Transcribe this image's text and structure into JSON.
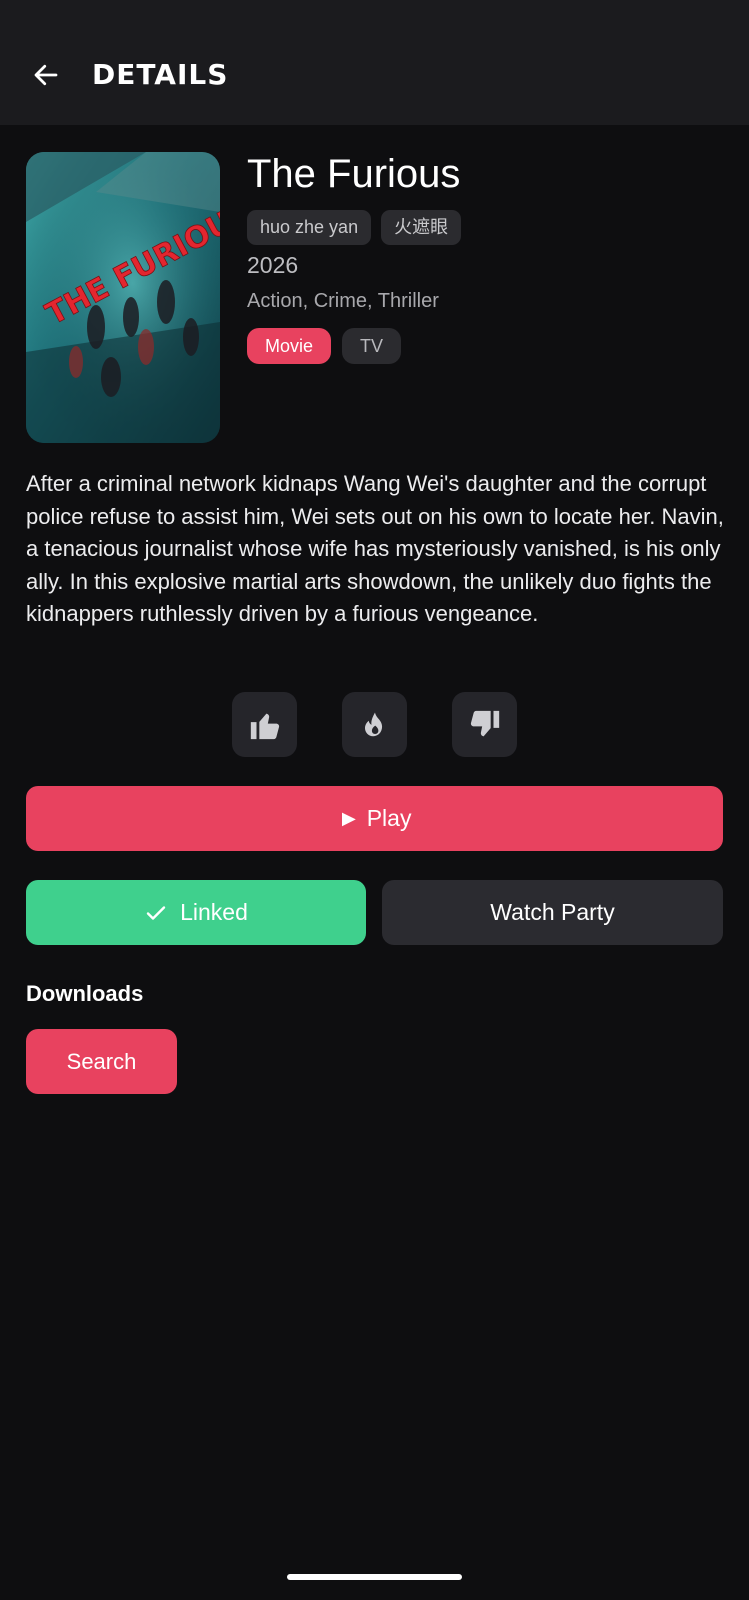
{
  "header": {
    "title": "DETAILS",
    "back_icon": "arrow-left-icon"
  },
  "movie": {
    "title": "The Furious",
    "alt_titles": [
      "huo zhe yan",
      "火遮眼"
    ],
    "year": "2026",
    "genres": "Action, Crime, Thriller",
    "poster_text": "THE FURIOUS",
    "types": [
      {
        "label": "Movie",
        "selected": true
      },
      {
        "label": "TV",
        "selected": false
      }
    ],
    "synopsis": "After a criminal network kidnaps Wang Wei's daughter and the corrupt police refuse to assist him, Wei sets out on his own to locate her. Navin, a tenacious journalist whose wife has mysteriously vanished, is his only ally. In this explosive martial arts showdown, the unlikely duo fights the kidnappers ruthlessly driven by a furious vengeance."
  },
  "reactions": [
    {
      "icon": "thumbs-up-icon"
    },
    {
      "icon": "fire-icon"
    },
    {
      "icon": "thumbs-down-icon"
    }
  ],
  "actions": {
    "play_label": "► Play",
    "linked_label": "Linked",
    "watch_party_label": "Watch Party"
  },
  "downloads": {
    "heading": "Downloads",
    "search_label": "Search"
  },
  "colors": {
    "accent": "#e8425f",
    "success": "#3fd08d",
    "background": "#0e0e10",
    "appbar": "#1b1b1e",
    "chip": "#2b2b2f"
  }
}
